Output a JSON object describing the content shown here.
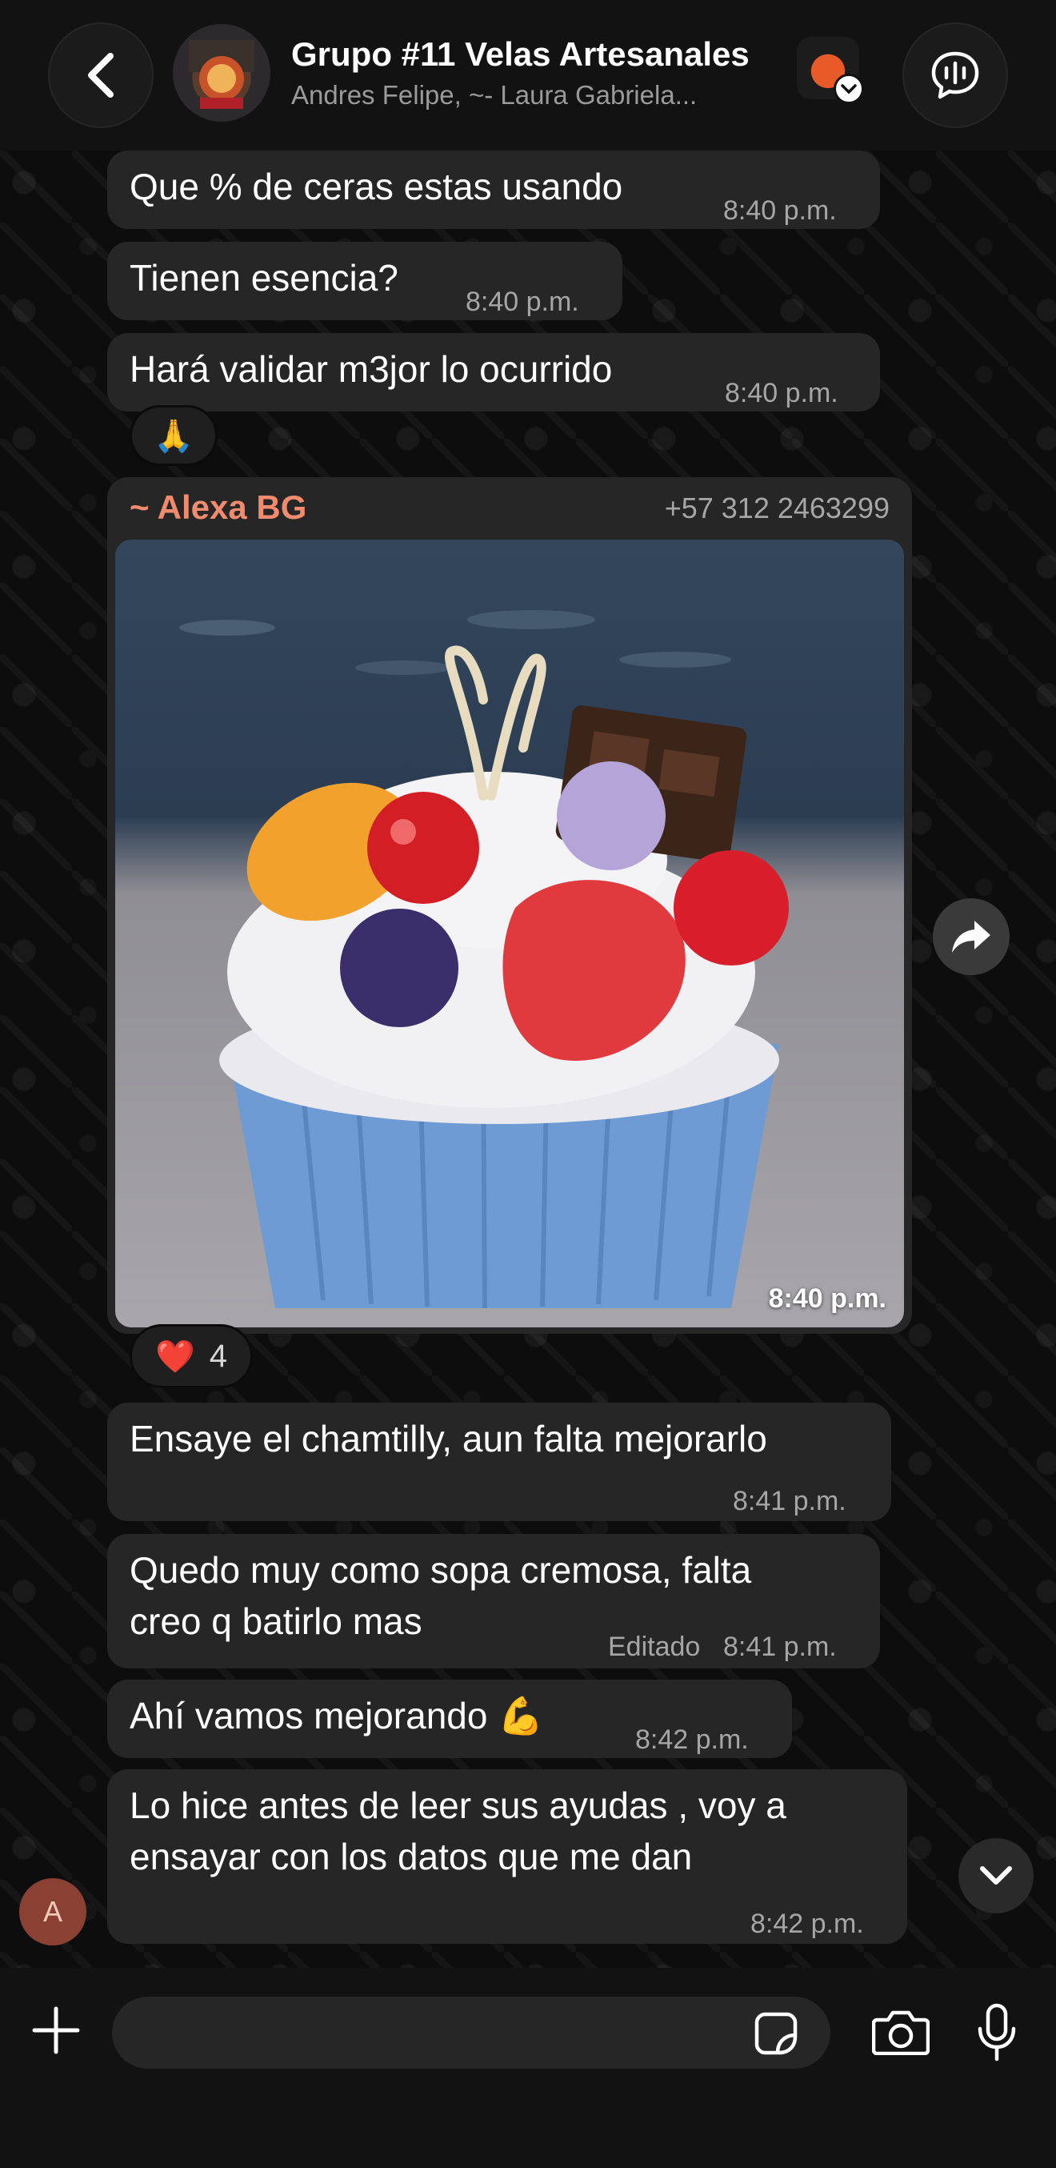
{
  "header": {
    "title": "Grupo #11 Velas Artesanales",
    "members": "Andres Felipe, ~- Laura Gabriela..."
  },
  "messages": [
    {
      "text": "Que % de ceras estas usando",
      "time": "8:40 p.m."
    },
    {
      "text": "Tienen esencia?",
      "time": "8:40 p.m."
    },
    {
      "text": "Hará validar m3jor lo ocurrido",
      "time": "8:40 p.m.",
      "reaction": "🙏"
    }
  ],
  "media_message": {
    "sender": "~ Alexa BG",
    "phone": "+57 312 2463299",
    "time": "8:40 p.m.",
    "reaction": {
      "emoji": "❤️",
      "count": "4"
    }
  },
  "messages_after": [
    {
      "text": "Ensaye el chamtilly, aun falta mejorarlo",
      "time": "8:41 p.m."
    },
    {
      "line1": "Quedo muy como sopa cremosa, falta",
      "line2": "creo q batirlo mas",
      "edited": "Editado",
      "time": "8:41 p.m."
    },
    {
      "text": "Ahí vamos mejorando 💪",
      "time": "8:42 p.m."
    },
    {
      "line1": "Lo hice antes de leer sus ayudas , voy a",
      "line2": "ensayar con los datos que me dan",
      "time": "8:42 p.m."
    }
  ],
  "user_avatar_initial": "A",
  "composer": {
    "placeholder": ""
  },
  "icons": {
    "back": "chevron-left-icon",
    "voice_chat": "voice-chat-icon",
    "forward": "forward-icon",
    "scroll_down": "chevron-down-icon",
    "attach": "plus-icon",
    "sticker": "sticker-icon",
    "camera": "camera-icon",
    "mic": "microphone-icon"
  },
  "colors": {
    "background": "#0b0b0b",
    "bubble": "#262626",
    "sender_name": "#f08b6e",
    "timestamp": "#a6a6a6"
  }
}
